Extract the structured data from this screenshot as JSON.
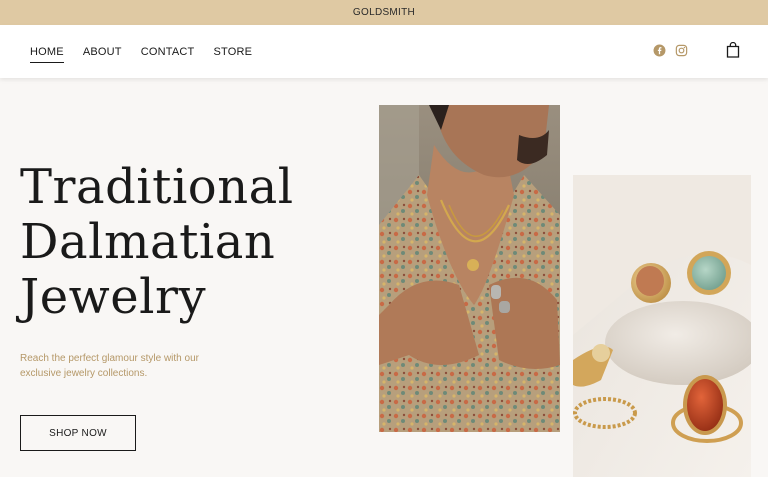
{
  "announcement": {
    "text": "GOLDSMITH"
  },
  "nav": {
    "items": [
      {
        "label": "HOME",
        "active": true
      },
      {
        "label": "ABOUT",
        "active": false
      },
      {
        "label": "CONTACT",
        "active": false
      },
      {
        "label": "STORE",
        "active": false
      }
    ]
  },
  "header_icons": {
    "social": [
      "facebook-icon",
      "instagram-icon"
    ],
    "cart": "shopping-bag-icon"
  },
  "hero": {
    "title_lines": [
      "Traditional",
      "Dalmatian",
      "Jewelry"
    ],
    "subtitle_lines": [
      "Reach the perfect glamour style with our",
      "exclusive jewelry collections."
    ],
    "cta_label": "SHOP NOW"
  },
  "colors": {
    "announcement_bg": "#dfc9a3",
    "accent_gold": "#b59868",
    "page_bg": "#f9f7f5",
    "text": "#1a1a1a"
  }
}
